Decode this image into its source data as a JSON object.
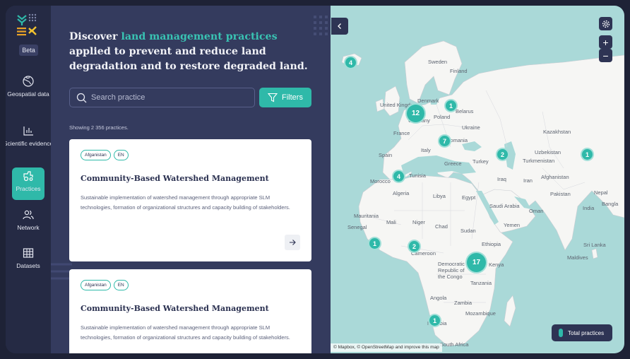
{
  "sidebar": {
    "beta_label": "Beta",
    "items": [
      {
        "label": "Geospatial data",
        "icon": "globe-icon"
      },
      {
        "label": "Scientific evidence",
        "icon": "bar-chart-icon"
      },
      {
        "label": "Practices",
        "icon": "tractor-icon",
        "active": true
      },
      {
        "label": "Network",
        "icon": "people-icon"
      },
      {
        "label": "Datasets",
        "icon": "table-icon"
      }
    ]
  },
  "panel": {
    "headline_before": "Discover ",
    "headline_accent": "land management practices",
    "headline_after": " applied to prevent and reduce land degradation and to restore degraded land.",
    "search_placeholder": "Search practice",
    "filters_label": "Filters",
    "showing_text": "Showing 2 356 practices.",
    "practices": [
      {
        "tags": [
          "Afganistan",
          "EN"
        ],
        "title": "Community-Based Watershed Management",
        "description": "Sustainable implementation of watershed management through appropriate SLM technologies, formation of organizational structures and capacity building of stakeholders."
      },
      {
        "tags": [
          "Afganistan",
          "EN"
        ],
        "title": "Community-Based Watershed Management",
        "description": "Sustainable implementation of watershed management through appropriate SLM technologies, formation of organizational structures and capacity building of stakeholders."
      }
    ]
  },
  "map": {
    "clusters": [
      {
        "count": "4",
        "place": "Iceland"
      },
      {
        "count": "12",
        "place": "Denmark"
      },
      {
        "count": "1",
        "place": "Belarus"
      },
      {
        "count": "7",
        "place": "Romania"
      },
      {
        "count": "2",
        "place": "Turkey"
      },
      {
        "count": "1",
        "place": "Kazakhstan"
      },
      {
        "count": "4",
        "place": "Tunisia"
      },
      {
        "count": "1",
        "place": "Mali"
      },
      {
        "count": "2",
        "place": "Nigeria"
      },
      {
        "count": "17",
        "place": "Kenya"
      },
      {
        "count": "1",
        "place": "Namibia"
      }
    ],
    "country_labels": [
      "Sweden",
      "Finland",
      "Denmark",
      "United Kingdom",
      "Belarus",
      "Poland",
      "Germany",
      "Ukraine",
      "France",
      "Romania",
      "Italy",
      "Spain",
      "Greece",
      "Turkey",
      "Kazakhstan",
      "Uzbekistan",
      "Turkmenistan",
      "Afghanistan",
      "Pakistan",
      "Iran",
      "Iraq",
      "India",
      "Nepal",
      "Bangla",
      "Morocco",
      "Tunisia",
      "Algeria",
      "Libya",
      "Egypt",
      "Saudi Arabia",
      "Oman",
      "Yemen",
      "Mauritania",
      "Mali",
      "Niger",
      "Chad",
      "Sudan",
      "Senegal",
      "Ethiopia",
      "Cameroon",
      "Democratic Republic of the Congo",
      "Kenya",
      "Tanzania",
      "Angola",
      "Zambia",
      "Mozambique",
      "Namibia",
      "South Africa",
      "Sri Lanka",
      "Maldives"
    ],
    "legend_label": "Total practices",
    "attribution": "© Mapbox, © OpenStreetMap and improve this map",
    "zoom_in": "+",
    "zoom_out": "−"
  },
  "colors": {
    "accent": "#2fb9a9",
    "sidebar_bg": "#252a44",
    "panel_bg": "#343b5e",
    "water": "#aad9d8",
    "land": "#f6f6f4"
  }
}
